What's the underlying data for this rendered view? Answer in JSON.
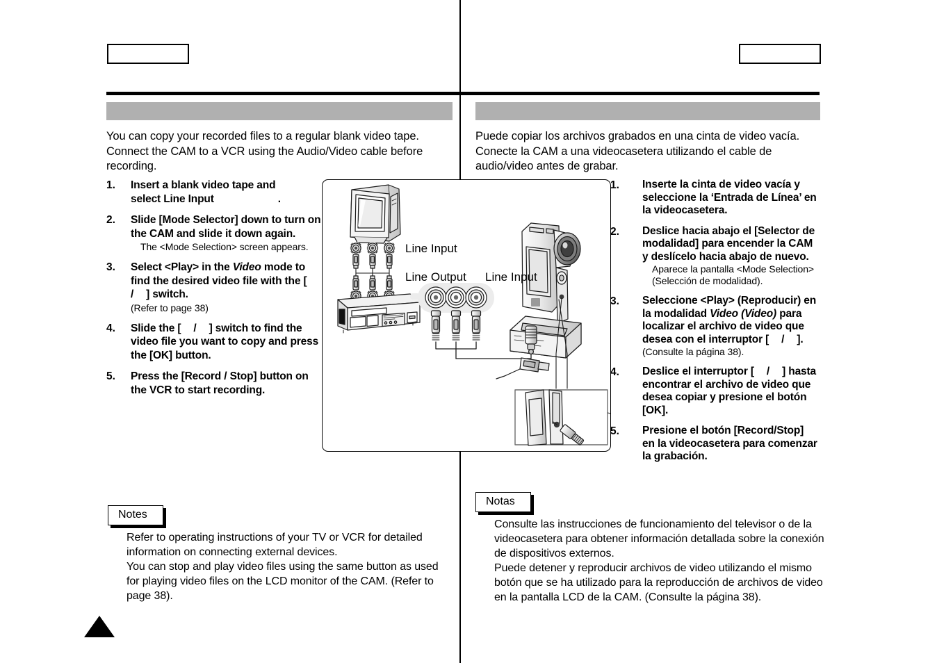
{
  "page": {
    "marker_icon": "up-triangle-page-marker",
    "header_left_box": "",
    "header_right_box": "",
    "title_bar_left": "",
    "title_bar_right": ""
  },
  "left_column": {
    "intro": "You can copy your recorded files to a regular blank video tape. Connect the CAM to a VCR using the Audio/Video cable before recording.",
    "steps": [
      {
        "num": "1.",
        "line1": "Insert a blank video tape and",
        "line2_a": "select  Line Input",
        "line2_b": ".",
        "sub": ""
      },
      {
        "num": "2.",
        "main": "Slide [Mode Selector] down to turn on the CAM and slide it down again.",
        "sub": "The <Mode Selection> screen appears."
      },
      {
        "num": "3.",
        "main_a": "Select <Play> in the ",
        "main_italic": "Video",
        "main_b": " mode to find the desired video file with the [",
        "main_c": "/",
        "main_d": "] switch.",
        "sub": "(Refer to page 38)"
      },
      {
        "num": "4.",
        "main_a": "Slide the [",
        "main_c": "/",
        "main_d": "] switch to find the video file you want to copy and press the [OK] button.",
        "sub": ""
      },
      {
        "num": "5.",
        "main": "Press the [Record / Stop] button on the VCR to start recording.",
        "sub": ""
      }
    ],
    "notes_label": "Notes",
    "notes_body": "Refer to operating instructions of your TV or VCR for detailed information on connecting external devices.\nYou can stop and play video files using the same button as used for playing video files on the LCD monitor of the CAM. (Refer to page 38)."
  },
  "right_column": {
    "intro": "Puede copiar los archivos grabados en una cinta de video vacía. Conecte la CAM a una videocasetera utilizando el cable de audio/video antes de grabar.",
    "steps": [
      {
        "num": "1.",
        "main": "Inserte la cinta de video vacía y seleccione la ‘Entrada de Línea’ en la videocasetera.",
        "sub": ""
      },
      {
        "num": "2.",
        "main": "Deslice hacia abajo el [Selector de modalidad] para encender la CAM y deslícelo hacia abajo de nuevo.",
        "sub": "Aparece la pantalla <Mode Selection> (Selección de modalidad)."
      },
      {
        "num": "3.",
        "main_a": "Seleccione <Play> (Reproducir) en la modalidad ",
        "main_italic": "Video (Video)",
        "main_b": " para localizar el archivo de video que desea con el interruptor  [",
        "main_c": "/",
        "main_d": "].",
        "sub": "(Consulte la página 38)."
      },
      {
        "num": "4.",
        "main_a": "Deslice el interruptor [",
        "main_c": "/",
        "main_d": "] hasta encontrar el archivo de video que desea copiar y presione el botón [OK].",
        "sub": ""
      },
      {
        "num": "5.",
        "main": "Presione el botón [Record/Stop] en la videocasetera para comenzar la grabación.",
        "sub": ""
      }
    ],
    "notes_label": "Notas",
    "notes_body": "Consulte las instrucciones de funcionamiento del televisor o de la videocasetera para obtener información detallada sobre la conexión de dispositivos externos.\nPuede detener y reproducir archivos de video utilizando el mismo botón que se ha utilizado para la reproducción de archivos de video en la pantalla LCD de la CAM. (Consulte la página 38)."
  },
  "diagram": {
    "name": "cam-to-vcr-connection-diagram",
    "labels": {
      "tv_line_input": "Line Input",
      "vcr_line_output": "Line Output",
      "cam_line_input": "Line Input"
    },
    "devices": [
      "television",
      "vcr",
      "rca-connectors",
      "camcorder",
      "cradle",
      "detail-callout"
    ]
  }
}
